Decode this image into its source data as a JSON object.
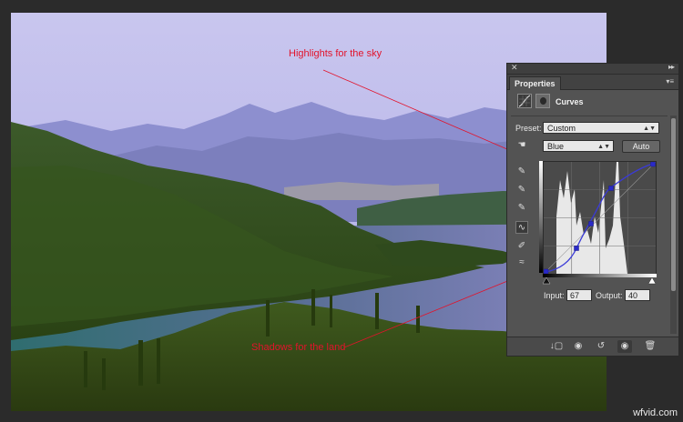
{
  "annotations": {
    "highlights": "Highlights for the sky",
    "shadows": "Shadows for the land",
    "color": "#e2132b"
  },
  "panel": {
    "tab_label": "Properties",
    "close_glyph": "✕",
    "collapse_glyph": "▸▸",
    "menu_glyph": "▾≡",
    "heading": "Curves",
    "preset_label": "Preset:",
    "preset_value": "Custom",
    "channel_value": "Blue",
    "auto_label": "Auto",
    "input_label": "Input:",
    "input_value": "67",
    "output_label": "Output:",
    "output_value": "40",
    "icons": {
      "header": [
        "curves-adjustment-icon",
        "layer-mask-icon"
      ],
      "tools": [
        "targeted-adjustment-icon",
        "eyedropper-black-icon",
        "eyedropper-gray-icon",
        "eyedropper-white-icon",
        "curve-edit-icon",
        "pencil-icon",
        "smooth-curve-icon"
      ],
      "bottom": [
        "clip-to-layer-icon",
        "view-previous-state-icon",
        "reset-icon",
        "visibility-icon",
        "delete-icon"
      ]
    },
    "curve_color": "#3a3ad8"
  },
  "watermark": "wfvid.com"
}
